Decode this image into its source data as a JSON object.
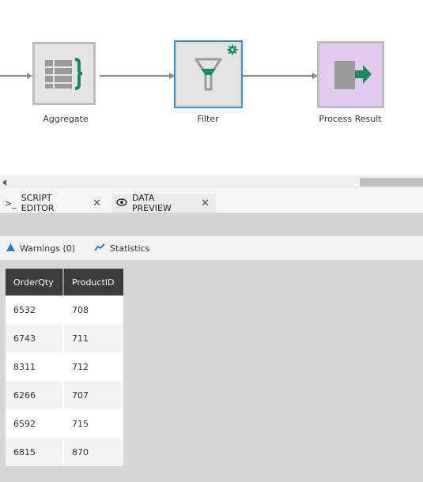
{
  "flow": {
    "nodes": [
      {
        "label": "Aggregate",
        "icon": "table-braces-icon"
      },
      {
        "label": "Filter",
        "icon": "funnel-icon",
        "badge": "gear-icon"
      },
      {
        "label": "Process Result",
        "icon": "export-arrow-icon"
      }
    ]
  },
  "tabs": [
    {
      "label": "SCRIPT EDITOR",
      "icon": "terminal-icon",
      "close": "✕"
    },
    {
      "label": "DATA PREVIEW",
      "icon": "data-preview-icon",
      "close": "✕"
    }
  ],
  "toolbar": {
    "warnings": "Warnings (0)",
    "statistics": "Statistics"
  },
  "table": {
    "columns": [
      "OrderQty",
      "ProductID"
    ],
    "rows": [
      [
        "6532",
        "708"
      ],
      [
        "6743",
        "711"
      ],
      [
        "8311",
        "712"
      ],
      [
        "6266",
        "707"
      ],
      [
        "6592",
        "715"
      ],
      [
        "6815",
        "870"
      ]
    ]
  },
  "colors": {
    "accent_green": "#1a8a5a",
    "selected_border": "#3f8fc6",
    "header_dark": "#3c3c3c",
    "process_node": "#e2c9ee"
  }
}
